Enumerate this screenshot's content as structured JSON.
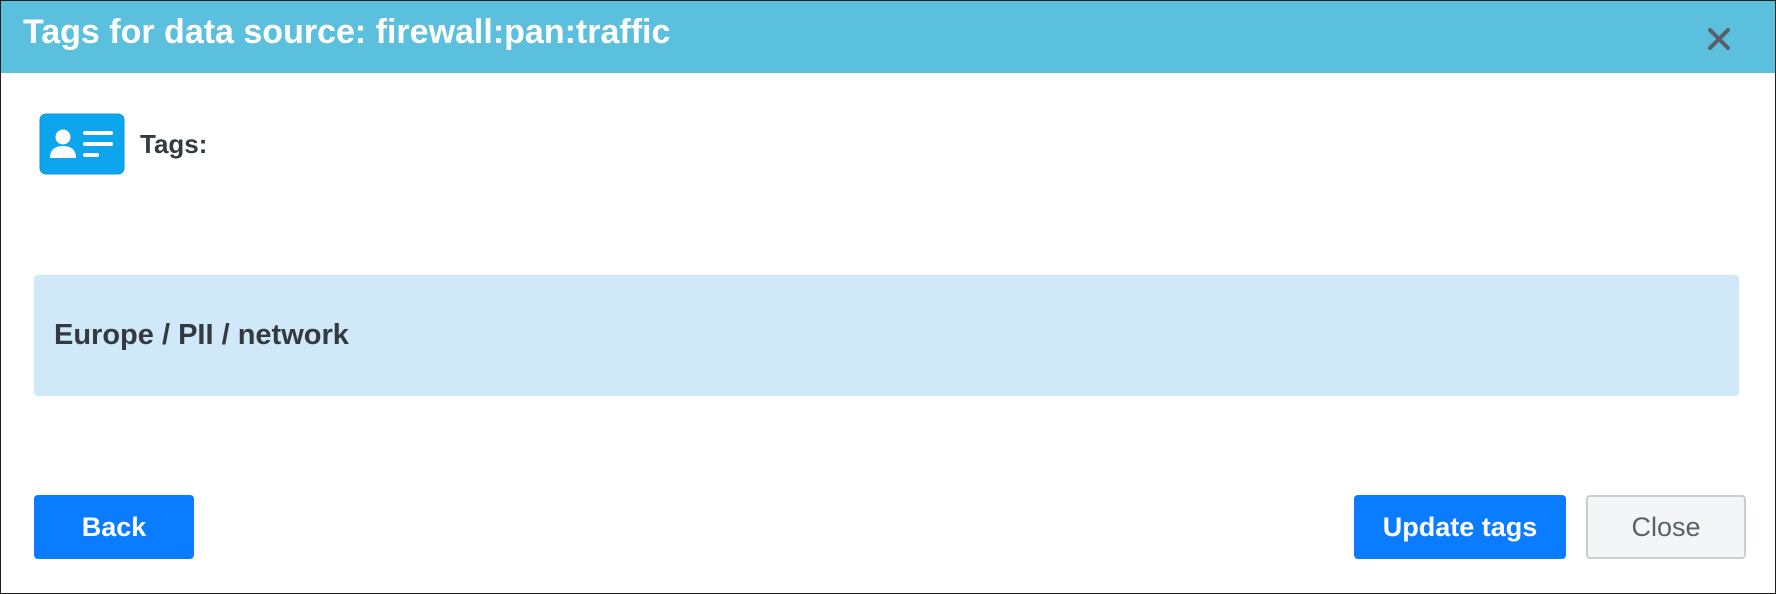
{
  "dialog": {
    "title": "Tags for data source: firewall:pan:traffic",
    "close_icon": "close-x-icon"
  },
  "tags_section": {
    "icon": "contact-card-icon",
    "label": "Tags:",
    "value": "Europe / PII / network"
  },
  "buttons": {
    "back_label": "Back",
    "update_label": "Update tags",
    "close_label": "Close"
  },
  "colors": {
    "header_bg": "#5bc0de",
    "primary": "#0a7cff",
    "tag_box_bg": "#cfe9f8",
    "icon_bg": "#0ea5ef"
  }
}
